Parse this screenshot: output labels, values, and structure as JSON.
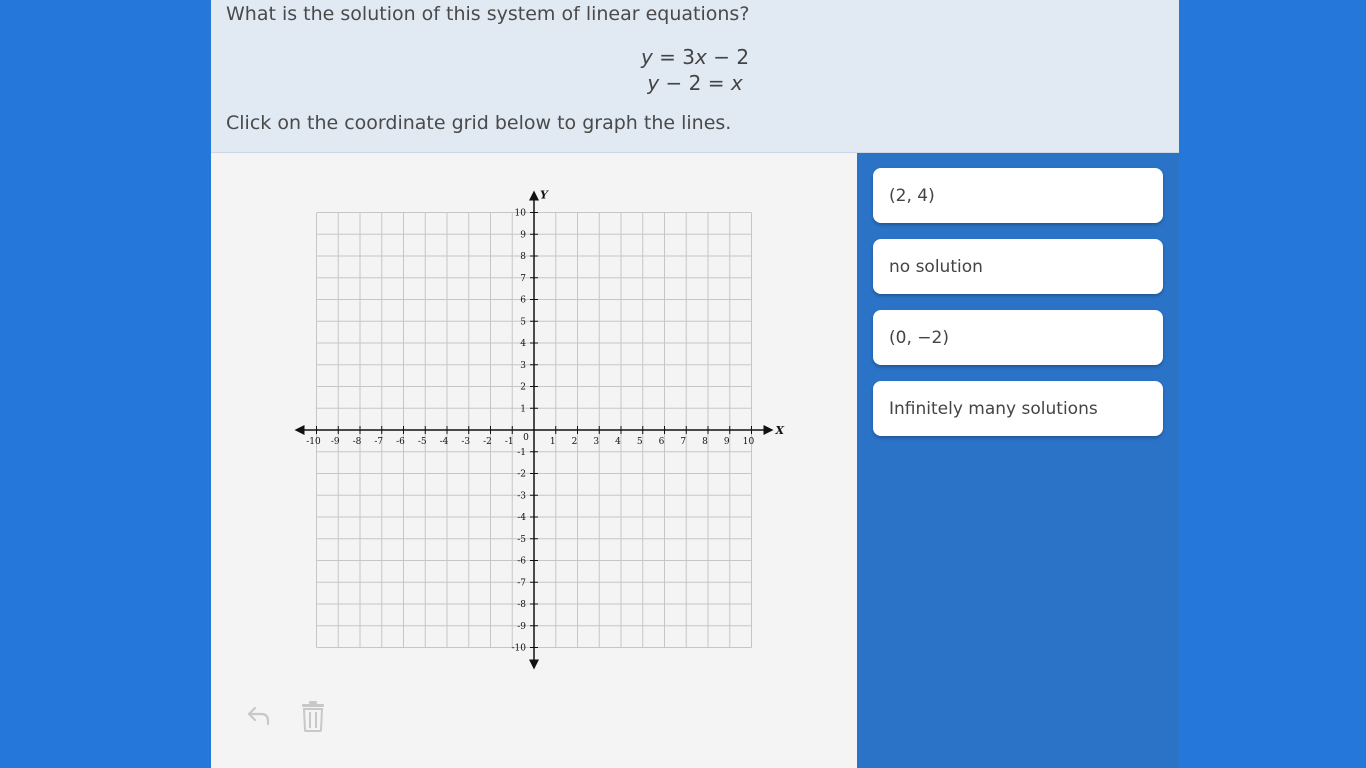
{
  "question": {
    "prompt": "What is the solution of this system of linear equations?",
    "equation_1": "y = 3x − 2",
    "equation_2": "y − 2 = x",
    "instruction": "Click on the coordinate grid below to graph the lines."
  },
  "graph": {
    "x_axis_label": "X",
    "y_axis_label": "Y",
    "origin_label": "0",
    "x_min": -10,
    "x_max": 10,
    "y_min": -10,
    "y_max": 10,
    "grid": true
  },
  "tools": {
    "undo_icon": "undo-arrow-icon",
    "delete_icon": "trash-icon"
  },
  "choices": [
    {
      "label": "(2, 4)"
    },
    {
      "label": "no solution"
    },
    {
      "label": "(0, −2)"
    },
    {
      "label": "Infinitely many solutions"
    }
  ],
  "colors": {
    "background": "#2578d9",
    "answer_panel": "#2b73c7",
    "question_panel": "#e1e9f3",
    "graph_panel": "#f4f4f4"
  }
}
